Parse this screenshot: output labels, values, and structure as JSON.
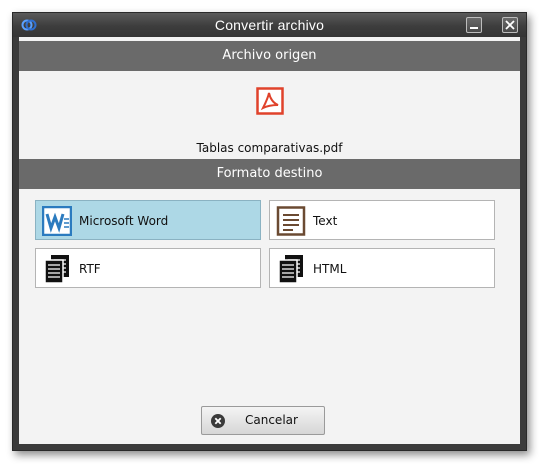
{
  "window": {
    "title": "Convertir archivo",
    "minimize_icon": "minimize-icon",
    "close_icon": "close-icon",
    "app_icon": "app-logo-icon"
  },
  "source": {
    "header": "Archivo origen",
    "file_icon": "pdf-icon",
    "file_name": "Tablas comparativas.pdf"
  },
  "target": {
    "header": "Formato destino",
    "formats": [
      {
        "label": "Microsoft Word",
        "icon": "word-icon",
        "selected": true
      },
      {
        "label": "Text",
        "icon": "text-document-icon",
        "selected": false
      },
      {
        "label": "RTF",
        "icon": "documents-icon",
        "selected": false
      },
      {
        "label": "HTML",
        "icon": "documents-icon",
        "selected": false
      }
    ]
  },
  "actions": {
    "cancel_label": "Cancelar",
    "cancel_icon": "close-circle-icon"
  },
  "colors": {
    "header_bg": "#6a6a6a",
    "selected_bg": "#add8e6",
    "pdf_red": "#e0422b",
    "word_blue": "#2b7bbf",
    "text_brown": "#6b4a32"
  }
}
